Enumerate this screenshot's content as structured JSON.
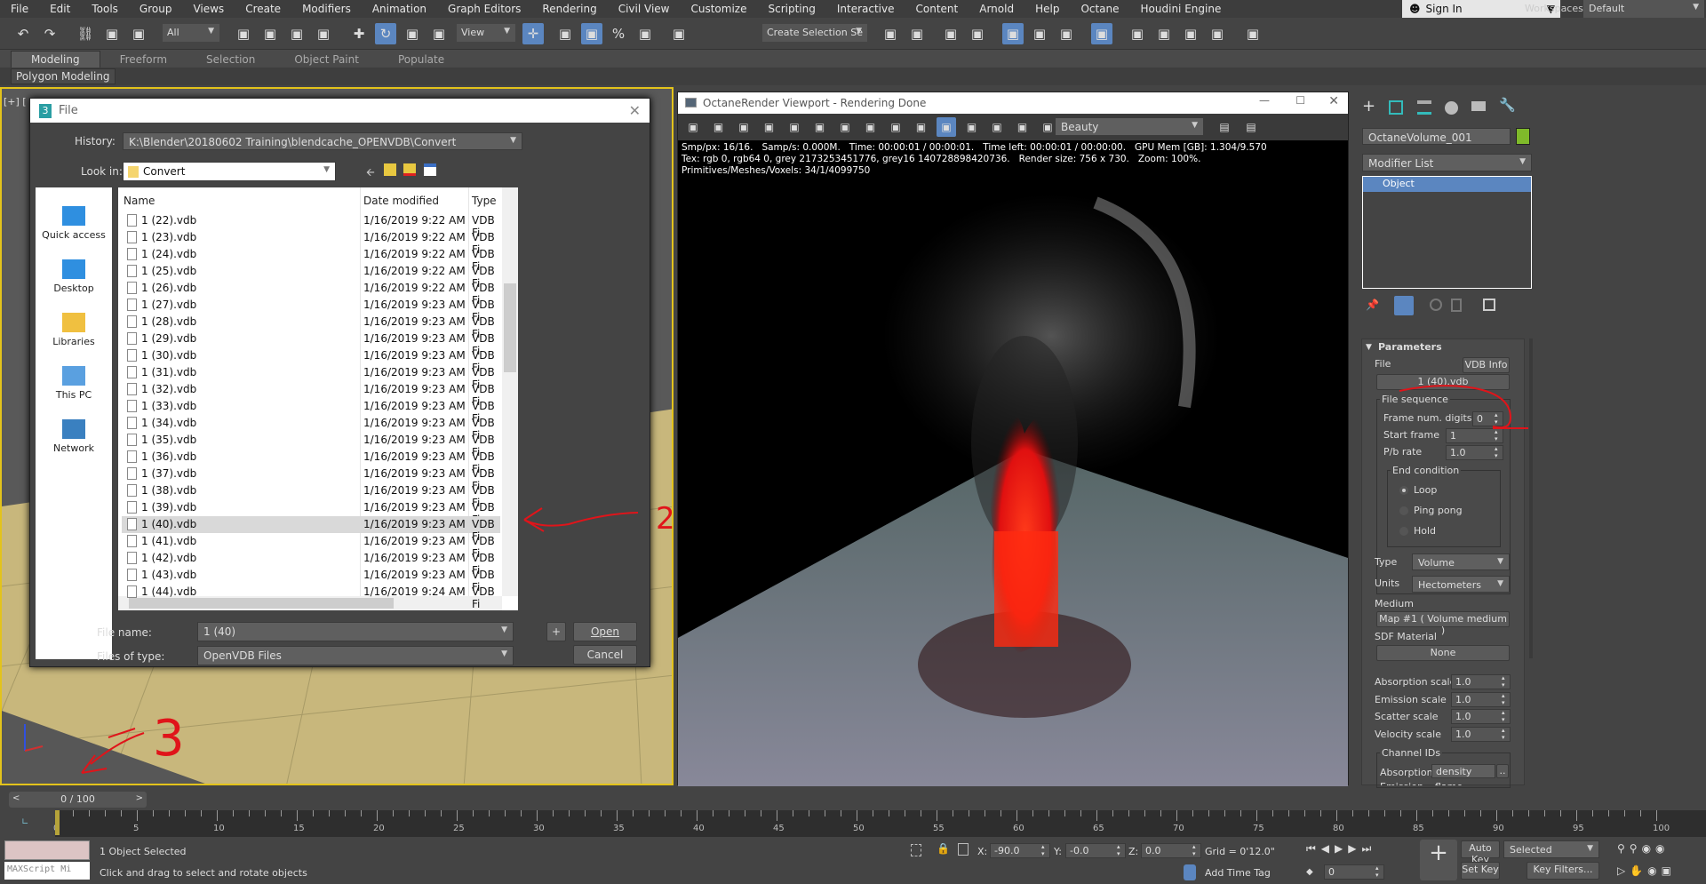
{
  "menu": [
    "File",
    "Edit",
    "Tools",
    "Group",
    "Views",
    "Create",
    "Modifiers",
    "Animation",
    "Graph Editors",
    "Rendering",
    "Civil View",
    "Customize",
    "Scripting",
    "Interactive",
    "Content",
    "Arnold",
    "Help",
    "Octane",
    "Houdini Engine"
  ],
  "account": {
    "sign_in": "Sign In",
    "workspaces_label": "Workspaces:",
    "workspace": "Default"
  },
  "toolbar": {
    "selection_filter": "All",
    "ref_coord": "View",
    "named_selection": "Create Selection Se"
  },
  "toolbar_icons": [
    "undo-icon",
    "redo-icon",
    "link-icon",
    "unlink-icon",
    "bind-space-warp-icon",
    "select-object-icon",
    "select-by-name-icon",
    "rectangle-selection-icon",
    "window-crossing-icon",
    "move-icon",
    "rotate-icon",
    "scale-icon",
    "pivot-center-icon",
    "pin-icon",
    "snap-3d-icon",
    "angle-snap-icon",
    "percent-snap-icon",
    "spinner-snap-icon",
    "edit-named-selection-icon",
    "mirror-icon",
    "align-icon",
    "scene-explorer-icon",
    "layer-explorer-icon",
    "ribbon-toggle-icon",
    "curve-editor-icon",
    "dope-sheet-icon",
    "schematic-view-icon",
    "render-setup-icon",
    "rendered-frame-window-icon",
    "render-production-icon",
    "render-cloud-icon",
    "octane-viewport-icon"
  ],
  "ribbon": {
    "tabs": [
      "Modeling",
      "Freeform",
      "Selection",
      "Object Paint",
      "Populate"
    ],
    "active": 0,
    "panel": "Polygon Modeling"
  },
  "viewport": {
    "label": "[+] ["
  },
  "file_dialog": {
    "title": "File",
    "history_label": "History:",
    "history": "K:\\Blender\\20180602 Training\\blendcache_OPENVDB\\Convert",
    "lookin_label": "Look in:",
    "lookin": "Convert",
    "places": [
      "Quick access",
      "Desktop",
      "Libraries",
      "This PC",
      "Network"
    ],
    "columns": [
      "Name",
      "Date modified",
      "Type"
    ],
    "files": [
      [
        "1 (22).vdb",
        "1/16/2019 9:22 AM",
        "VDB Fi"
      ],
      [
        "1 (23).vdb",
        "1/16/2019 9:22 AM",
        "VDB Fi"
      ],
      [
        "1 (24).vdb",
        "1/16/2019 9:22 AM",
        "VDB Fi"
      ],
      [
        "1 (25).vdb",
        "1/16/2019 9:22 AM",
        "VDB Fi"
      ],
      [
        "1 (26).vdb",
        "1/16/2019 9:22 AM",
        "VDB Fi"
      ],
      [
        "1 (27).vdb",
        "1/16/2019 9:23 AM",
        "VDB Fi"
      ],
      [
        "1 (28).vdb",
        "1/16/2019 9:23 AM",
        "VDB Fi"
      ],
      [
        "1 (29).vdb",
        "1/16/2019 9:23 AM",
        "VDB Fi"
      ],
      [
        "1 (30).vdb",
        "1/16/2019 9:23 AM",
        "VDB Fi"
      ],
      [
        "1 (31).vdb",
        "1/16/2019 9:23 AM",
        "VDB Fi"
      ],
      [
        "1 (32).vdb",
        "1/16/2019 9:23 AM",
        "VDB Fi"
      ],
      [
        "1 (33).vdb",
        "1/16/2019 9:23 AM",
        "VDB Fi"
      ],
      [
        "1 (34).vdb",
        "1/16/2019 9:23 AM",
        "VDB Fi"
      ],
      [
        "1 (35).vdb",
        "1/16/2019 9:23 AM",
        "VDB Fi"
      ],
      [
        "1 (36).vdb",
        "1/16/2019 9:23 AM",
        "VDB Fi"
      ],
      [
        "1 (37).vdb",
        "1/16/2019 9:23 AM",
        "VDB Fi"
      ],
      [
        "1 (38).vdb",
        "1/16/2019 9:23 AM",
        "VDB Fi"
      ],
      [
        "1 (39).vdb",
        "1/16/2019 9:23 AM",
        "VDB Fi"
      ],
      [
        "1 (40).vdb",
        "1/16/2019 9:23 AM",
        "VDB Fi"
      ],
      [
        "1 (41).vdb",
        "1/16/2019 9:23 AM",
        "VDB Fi"
      ],
      [
        "1 (42).vdb",
        "1/16/2019 9:23 AM",
        "VDB Fi"
      ],
      [
        "1 (43).vdb",
        "1/16/2019 9:23 AM",
        "VDB Fi"
      ],
      [
        "1 (44).vdb",
        "1/16/2019 9:24 AM",
        "VDB Fi"
      ]
    ],
    "selected_file": "1 (40).vdb",
    "filename_label": "File name:",
    "filename": "1 (40)",
    "filetype_label": "Files of type:",
    "filetype": "OpenVDB Files",
    "plus": "+",
    "open": "Open",
    "cancel": "Cancel"
  },
  "octane": {
    "title": "OctaneRender Viewport - Rendering Done",
    "pass": "Beauty",
    "info": [
      "Smp/px: 16/16.   Samp/s: 0.000M.   Time: 00:00:01 / 00:00:01.   Time left: 00:00:01 / 00:00:00.   GPU Mem [GB]: 1.304/9.570",
      "Tex: rgb 0, rgb64 0, grey 2173253451776, grey16 140728898420736.   Render size: 756 x 730.   Zoom: 100%.",
      "Primitives/Meshes/Voxels: 34/1/4099750"
    ]
  },
  "command_panel": {
    "object_name": "OctaneVolume_001",
    "object_color": "#7fba2a",
    "modifier_list": "Modifier List",
    "stack": [
      "Object"
    ],
    "parameters": {
      "title": "Parameters",
      "file_label": "File",
      "vdb_info": "VDB Info",
      "file": "1 (40).vdb",
      "file_sequence": "File sequence",
      "frame_digits_label": "Frame num. digits",
      "frame_digits": "0",
      "start_frame_label": "Start frame",
      "start_frame": "1",
      "pb_rate_label": "P/b rate",
      "pb_rate": "1.0",
      "end_condition": "End condition",
      "end_options": [
        "Loop",
        "Ping pong",
        "Hold"
      ],
      "end_selected": "Loop",
      "type_label": "Type",
      "type": "Volume",
      "units_label": "Units",
      "units": "Hectometers",
      "medium_label": "Medium",
      "medium": "Map #1  ( Volume medium )",
      "sdf_label": "SDF Material",
      "sdf": "None",
      "scales": [
        [
          "Absorption scale",
          "1.0"
        ],
        [
          "Emission scale",
          "1.0"
        ],
        [
          "Scatter scale",
          "1.0"
        ],
        [
          "Velocity scale",
          "1.0"
        ]
      ],
      "channel_ids": "Channel IDs",
      "absorption_label": "Absorption",
      "absorption": "density",
      "dots": "..",
      "emission_label": "Emission",
      "emission": "flame"
    }
  },
  "timeline": {
    "frame": "0 / 100",
    "current": 0,
    "total": 100,
    "ticks": [
      "0",
      "5",
      "10",
      "15",
      "20",
      "25",
      "30",
      "35",
      "40",
      "45",
      "50",
      "55",
      "60",
      "65",
      "70",
      "75",
      "80",
      "85",
      "90",
      "95",
      "100"
    ]
  },
  "status": {
    "maxscript": "MAXScript Mi",
    "selected": "1 Object Selected",
    "prompt": "Click and drag to select and rotate objects",
    "x_label": "X:",
    "x": "-90.0",
    "y_label": "Y:",
    "y": "-0.0",
    "z_label": "Z:",
    "z": "0.0",
    "grid": "Grid = 0'12.0\"",
    "add_time_tag": "Add Time Tag",
    "auto_key": "Auto Key",
    "set_key": "Set Key",
    "key_mode": "Selected",
    "key_filters": "Key Filters...",
    "frame_field": "0"
  },
  "annotations": [
    "1",
    "2",
    "3"
  ],
  "colors": {
    "selection": "#5b86c0",
    "viewport_border": "#e3c31b",
    "annotation": "#e0141a"
  }
}
